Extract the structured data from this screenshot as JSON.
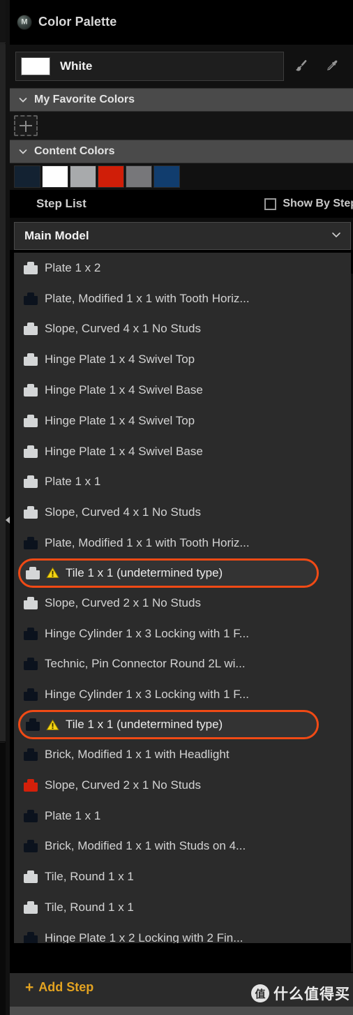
{
  "window": {
    "title": "Color Palette",
    "logo_icon": "app-logo-icon"
  },
  "color_field": {
    "selected_color_name": "White",
    "selected_color_hex": "#ffffff",
    "tools": [
      {
        "name": "paintbrush-icon",
        "label": "Paint"
      },
      {
        "name": "eyedropper-icon",
        "label": "Pick Color"
      }
    ]
  },
  "favorites": {
    "header": "My Favorite Colors",
    "chevron": "chevron-down-icon",
    "add_label": "+"
  },
  "content_colors": {
    "header": "Content Colors",
    "chevron": "chevron-down-icon",
    "swatches": [
      "#132232",
      "#fefefe",
      "#a8aaac",
      "#d01e08",
      "#77777a",
      "#113d6e"
    ]
  },
  "step_list": {
    "title": "Step List",
    "show_by_step_label": "Show By Step",
    "show_by_step_checked": false,
    "model_name": "Main Model",
    "model_chevron": "chevron-down-icon",
    "add_step_label": "Add Step",
    "add_step_plus": "+",
    "items": [
      {
        "label": "Plate 1 x 2",
        "color": "#d4d6d7",
        "flagged": false
      },
      {
        "label": "Plate, Modified 1 x 1 with Tooth Horiz...",
        "color": "#0b121d",
        "flagged": false
      },
      {
        "label": "Slope, Curved 4 x 1 No Studs",
        "color": "#d4d6d7",
        "flagged": false
      },
      {
        "label": "Hinge Plate 1 x 4 Swivel Top",
        "color": "#d4d6d7",
        "flagged": false
      },
      {
        "label": "Hinge Plate 1 x 4 Swivel Base",
        "color": "#d4d6d7",
        "flagged": false
      },
      {
        "label": "Hinge Plate 1 x 4 Swivel Top",
        "color": "#d4d6d7",
        "flagged": false
      },
      {
        "label": "Hinge Plate 1 x 4 Swivel Base",
        "color": "#d4d6d7",
        "flagged": false
      },
      {
        "label": "Plate 1 x 1",
        "color": "#d4d6d7",
        "flagged": false
      },
      {
        "label": "Slope, Curved 4 x 1 No Studs",
        "color": "#d4d6d7",
        "flagged": false
      },
      {
        "label": "Plate, Modified 1 x 1 with Tooth Horiz...",
        "color": "#0b121d",
        "flagged": false
      },
      {
        "label": "Tile 1 x 1 (undetermined type)",
        "color": "#d4d6d7",
        "flagged": true,
        "warning": "warning-triangle-icon"
      },
      {
        "label": "Slope, Curved 2 x 1 No Studs",
        "color": "#d4d6d7",
        "flagged": false
      },
      {
        "label": "Hinge Cylinder 1 x 3 Locking with 1 F...",
        "color": "#0b121d",
        "flagged": false
      },
      {
        "label": "Technic, Pin Connector Round 2L wi...",
        "color": "#0b121d",
        "flagged": false
      },
      {
        "label": "Hinge Cylinder 1 x 3 Locking with 1 F...",
        "color": "#0b121d",
        "flagged": false
      },
      {
        "label": "Tile 1 x 1 (undetermined type)",
        "color": "#0b121d",
        "flagged": true,
        "warning": "warning-triangle-icon"
      },
      {
        "label": "Brick, Modified 1 x 1 with Headlight",
        "color": "#0b121d",
        "flagged": false
      },
      {
        "label": "Slope, Curved 2 x 1 No Studs",
        "color": "#d4200a",
        "flagged": false
      },
      {
        "label": "Plate 1 x 1",
        "color": "#0b121d",
        "flagged": false
      },
      {
        "label": "Brick, Modified 1 x 1 with Studs on 4...",
        "color": "#0b121d",
        "flagged": false
      },
      {
        "label": "Tile, Round 1 x 1",
        "color": "#d4d6d7",
        "flagged": false
      },
      {
        "label": "Tile, Round 1 x 1",
        "color": "#d4d6d7",
        "flagged": false
      },
      {
        "label": "Hinge Plate 1 x 2 Locking with 2 Fin...",
        "color": "#0b121d",
        "flagged": false
      }
    ]
  },
  "watermark": {
    "logo_char": "值",
    "text": "什么值得买"
  },
  "colors": {
    "accent_orange": "#f04a15",
    "accent_gold": "#e3a321",
    "warning_yellow": "#f5d512",
    "panel_bg": "#2b2b2b",
    "header_bg": "#4a4a4a"
  }
}
